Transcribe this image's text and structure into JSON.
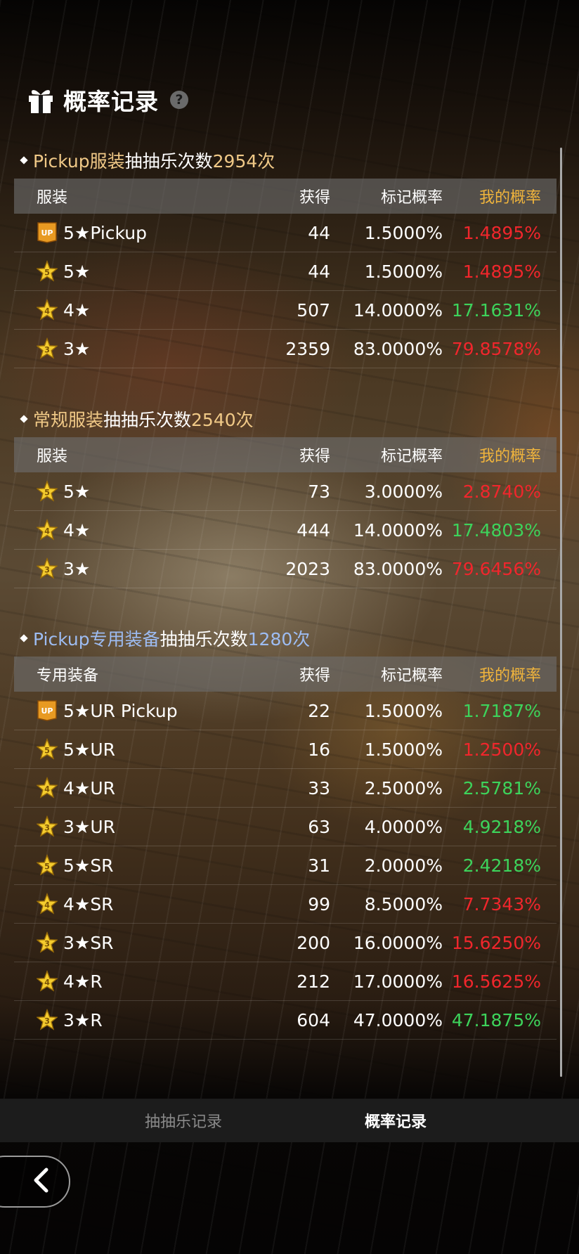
{
  "page": {
    "title": "概率记录",
    "help_symbol": "?"
  },
  "sections": [
    {
      "title_prefix": "Pickup服装",
      "title_middle": "抽抽乐次数",
      "title_count": "2954次",
      "headers": {
        "name": "服装",
        "obtained": "获得",
        "marked_rate": "标记概率",
        "my_rate": "我的概率"
      },
      "rows": [
        {
          "icon": "up-badge-icon",
          "name": "5★Pickup",
          "obtained": "44",
          "marked_rate": "1.5000%",
          "my_rate": "1.4895%",
          "my_rate_color": "#f0262c"
        },
        {
          "icon": "star-5-icon",
          "name": "5★",
          "obtained": "44",
          "marked_rate": "1.5000%",
          "my_rate": "1.4895%",
          "my_rate_color": "#f0262c"
        },
        {
          "icon": "star-4-icon",
          "name": "4★",
          "obtained": "507",
          "marked_rate": "14.0000%",
          "my_rate": "17.1631%",
          "my_rate_color": "#3dd35b"
        },
        {
          "icon": "star-3-icon",
          "name": "3★",
          "obtained": "2359",
          "marked_rate": "83.0000%",
          "my_rate": "79.8578%",
          "my_rate_color": "#f0262c"
        }
      ]
    },
    {
      "title_prefix": "常规服装",
      "title_middle": "抽抽乐次数",
      "title_count": "2540次",
      "headers": {
        "name": "服装",
        "obtained": "获得",
        "marked_rate": "标记概率",
        "my_rate": "我的概率"
      },
      "rows": [
        {
          "icon": "star-5-icon",
          "name": "5★",
          "obtained": "73",
          "marked_rate": "3.0000%",
          "my_rate": "2.8740%",
          "my_rate_color": "#f0262c"
        },
        {
          "icon": "star-4-icon",
          "name": "4★",
          "obtained": "444",
          "marked_rate": "14.0000%",
          "my_rate": "17.4803%",
          "my_rate_color": "#3dd35b"
        },
        {
          "icon": "star-3-icon",
          "name": "3★",
          "obtained": "2023",
          "marked_rate": "83.0000%",
          "my_rate": "79.6456%",
          "my_rate_color": "#f0262c"
        }
      ]
    },
    {
      "title_prefix": "Pickup专用装备",
      "title_middle": "抽抽乐次数",
      "title_count": "1280次",
      "headers": {
        "name": "专用装备",
        "obtained": "获得",
        "marked_rate": "标记概率",
        "my_rate": "我的概率"
      },
      "rows": [
        {
          "icon": "up-badge-icon",
          "name": "5★UR Pickup",
          "obtained": "22",
          "marked_rate": "1.5000%",
          "my_rate": "1.7187%",
          "my_rate_color": "#3dd35b"
        },
        {
          "icon": "star-5-icon",
          "name": "5★UR",
          "obtained": "16",
          "marked_rate": "1.5000%",
          "my_rate": "1.2500%",
          "my_rate_color": "#f0262c"
        },
        {
          "icon": "star-4-icon",
          "name": "4★UR",
          "obtained": "33",
          "marked_rate": "2.5000%",
          "my_rate": "2.5781%",
          "my_rate_color": "#3dd35b"
        },
        {
          "icon": "star-3-icon",
          "name": "3★UR",
          "obtained": "63",
          "marked_rate": "4.0000%",
          "my_rate": "4.9218%",
          "my_rate_color": "#3dd35b"
        },
        {
          "icon": "star-5-icon",
          "name": "5★SR",
          "obtained": "31",
          "marked_rate": "2.0000%",
          "my_rate": "2.4218%",
          "my_rate_color": "#3dd35b"
        },
        {
          "icon": "star-4-icon",
          "name": "4★SR",
          "obtained": "99",
          "marked_rate": "8.5000%",
          "my_rate": "7.7343%",
          "my_rate_color": "#f0262c"
        },
        {
          "icon": "star-3-icon",
          "name": "3★SR",
          "obtained": "200",
          "marked_rate": "16.0000%",
          "my_rate": "15.6250%",
          "my_rate_color": "#f0262c"
        },
        {
          "icon": "star-4-icon",
          "name": "4★R",
          "obtained": "212",
          "marked_rate": "17.0000%",
          "my_rate": "16.5625%",
          "my_rate_color": "#f0262c"
        },
        {
          "icon": "star-3-icon",
          "name": "3★R",
          "obtained": "604",
          "marked_rate": "47.0000%",
          "my_rate": "47.1875%",
          "my_rate_color": "#3dd35b"
        }
      ]
    }
  ],
  "tabs": [
    {
      "label": "抽抽乐记录",
      "active": false
    },
    {
      "label": "概率记录",
      "active": true
    }
  ],
  "icon_labels": {
    "up_badge": "UP",
    "star_5": "5",
    "star_4": "4",
    "star_3": "3"
  },
  "colors": {
    "gold_highlight": "#f0c987",
    "blue_highlight": "#9dbcf2",
    "my_rate_header": "#f0b43c",
    "positive": "#3dd35b",
    "negative": "#f0262c"
  }
}
